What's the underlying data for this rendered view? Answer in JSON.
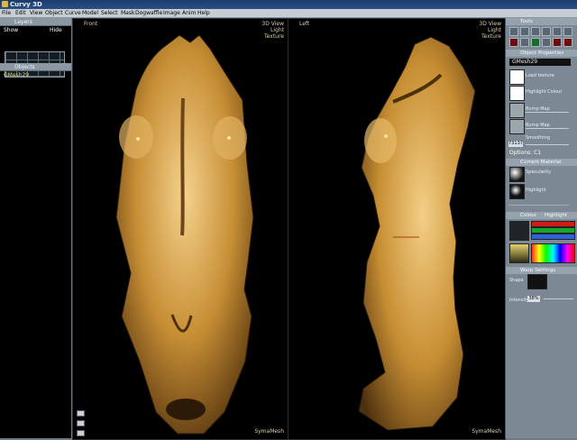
{
  "window": {
    "title": "Curvy 3D"
  },
  "menu": [
    "File",
    "Edit",
    "View",
    "Object",
    "Curve",
    "Model",
    "Select",
    "Mask",
    "Dogwaffle",
    "Image",
    "Anim",
    "Help"
  ],
  "left": {
    "layers_title": "Layers",
    "show_label": "Show",
    "hide_label": "Hide",
    "objects_title": "Objects",
    "object_name": "GMesh29"
  },
  "viewports": {
    "front": {
      "label": "Front",
      "mode1": "3D View",
      "mode2": "Light",
      "mode3": "Texture",
      "footer": "SymaMesh"
    },
    "left": {
      "label": "Left",
      "mode1": "3D View",
      "mode2": "Light",
      "mode3": "Texture",
      "footer": "SymaMesh"
    }
  },
  "right": {
    "tools_title": "Tools",
    "properties_title": "Object Properties",
    "object_name": "GMesh29",
    "texture_label": "Load texture",
    "highlight_label": "Highlight Colour",
    "bump_label": "Bump Map",
    "normal_label": "Bump Map",
    "smooth_label": "Smoothing",
    "poly_count": "73137",
    "options_label": "Options: C1",
    "material_title": "Current Material",
    "specular_label": "Specularity",
    "highlight2_label": "Highlight",
    "colour_title": "Colour",
    "highlight_tab": "Highlight",
    "warp_title": "Warp Settings",
    "shape_label": "Shape",
    "intensity_label": "Intensity",
    "intensity_value": "38%"
  },
  "colors": {
    "skin": "#c9953c",
    "accent_red": "#d21d16",
    "accent_green": "#16a72f",
    "accent_blue": "#2d62da"
  }
}
